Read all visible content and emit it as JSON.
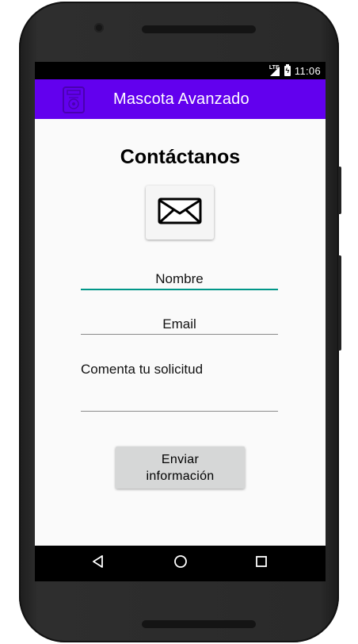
{
  "status_bar": {
    "network": "LTE",
    "time": "11:06"
  },
  "app_bar": {
    "title": "Mascota Avanzado",
    "logo_icon": "pet-logo-icon"
  },
  "main": {
    "heading": "Contáctanos",
    "mail_button_icon": "envelope-icon",
    "name_field": {
      "value": "Nombre"
    },
    "email_field": {
      "value": "Email"
    },
    "comment_field": {
      "value": "Comenta tu solicitud"
    },
    "submit_button_label": "Enviar información"
  },
  "nav_bar": {
    "back_icon": "back-triangle-icon",
    "home_icon": "home-circle-icon",
    "recents_icon": "recents-square-icon"
  },
  "colors": {
    "app_bar": "#6200ee",
    "focus_underline": "#009688",
    "screen_background": "#fafafa",
    "button_background": "#d6d7d7"
  }
}
